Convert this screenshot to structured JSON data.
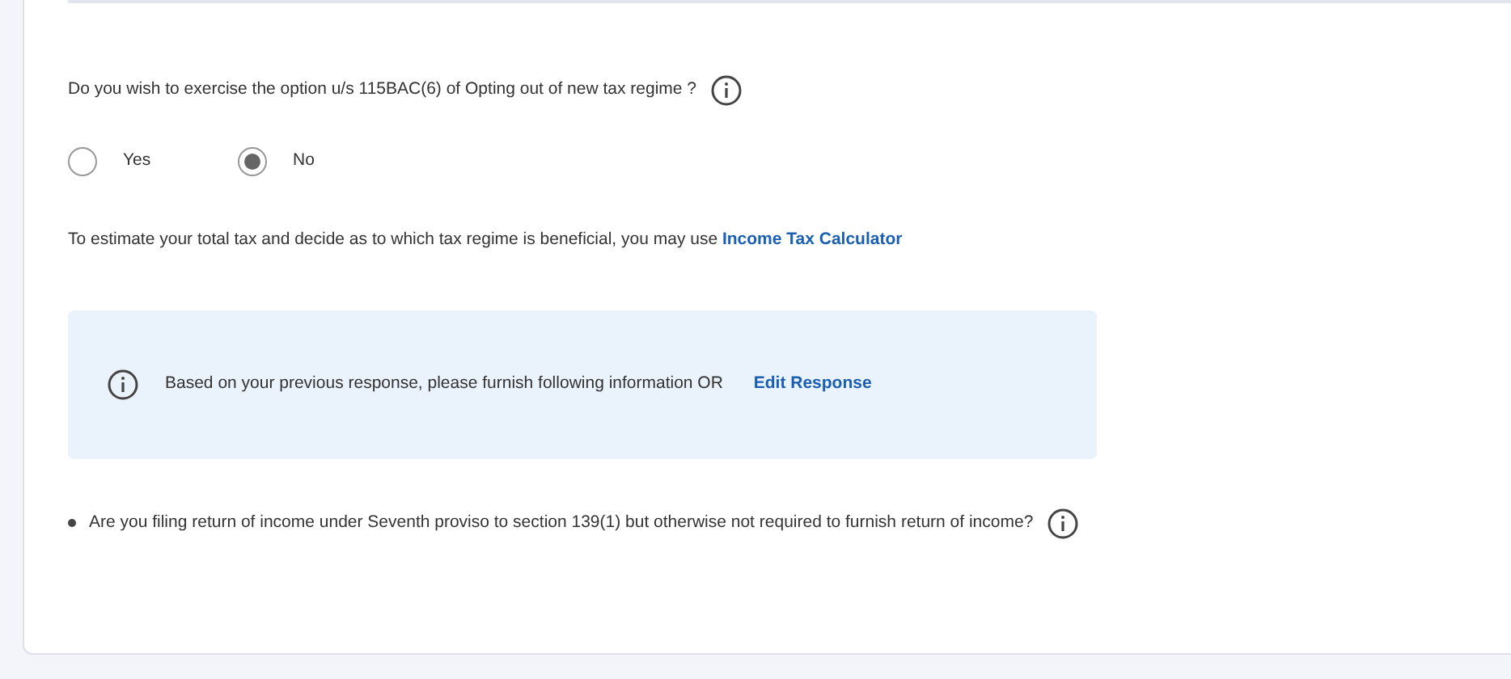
{
  "question": {
    "text": "Do you wish to exercise the option u/s 115BAC(6) of Opting out of new tax regime ?"
  },
  "options": [
    {
      "label": "Yes",
      "selected": false
    },
    {
      "label": "No",
      "selected": true
    }
  ],
  "estimate": {
    "text": "To estimate your total tax and decide as to which tax regime is beneficial, you may use",
    "link": "Income Tax Calculator"
  },
  "notice": {
    "text": "Based on your previous response, please furnish following information OR",
    "link": "Edit Response"
  },
  "bullets": [
    {
      "text": "Are you filing return of income under Seventh proviso to section 139(1) but otherwise not required to furnish return of income?"
    }
  ]
}
